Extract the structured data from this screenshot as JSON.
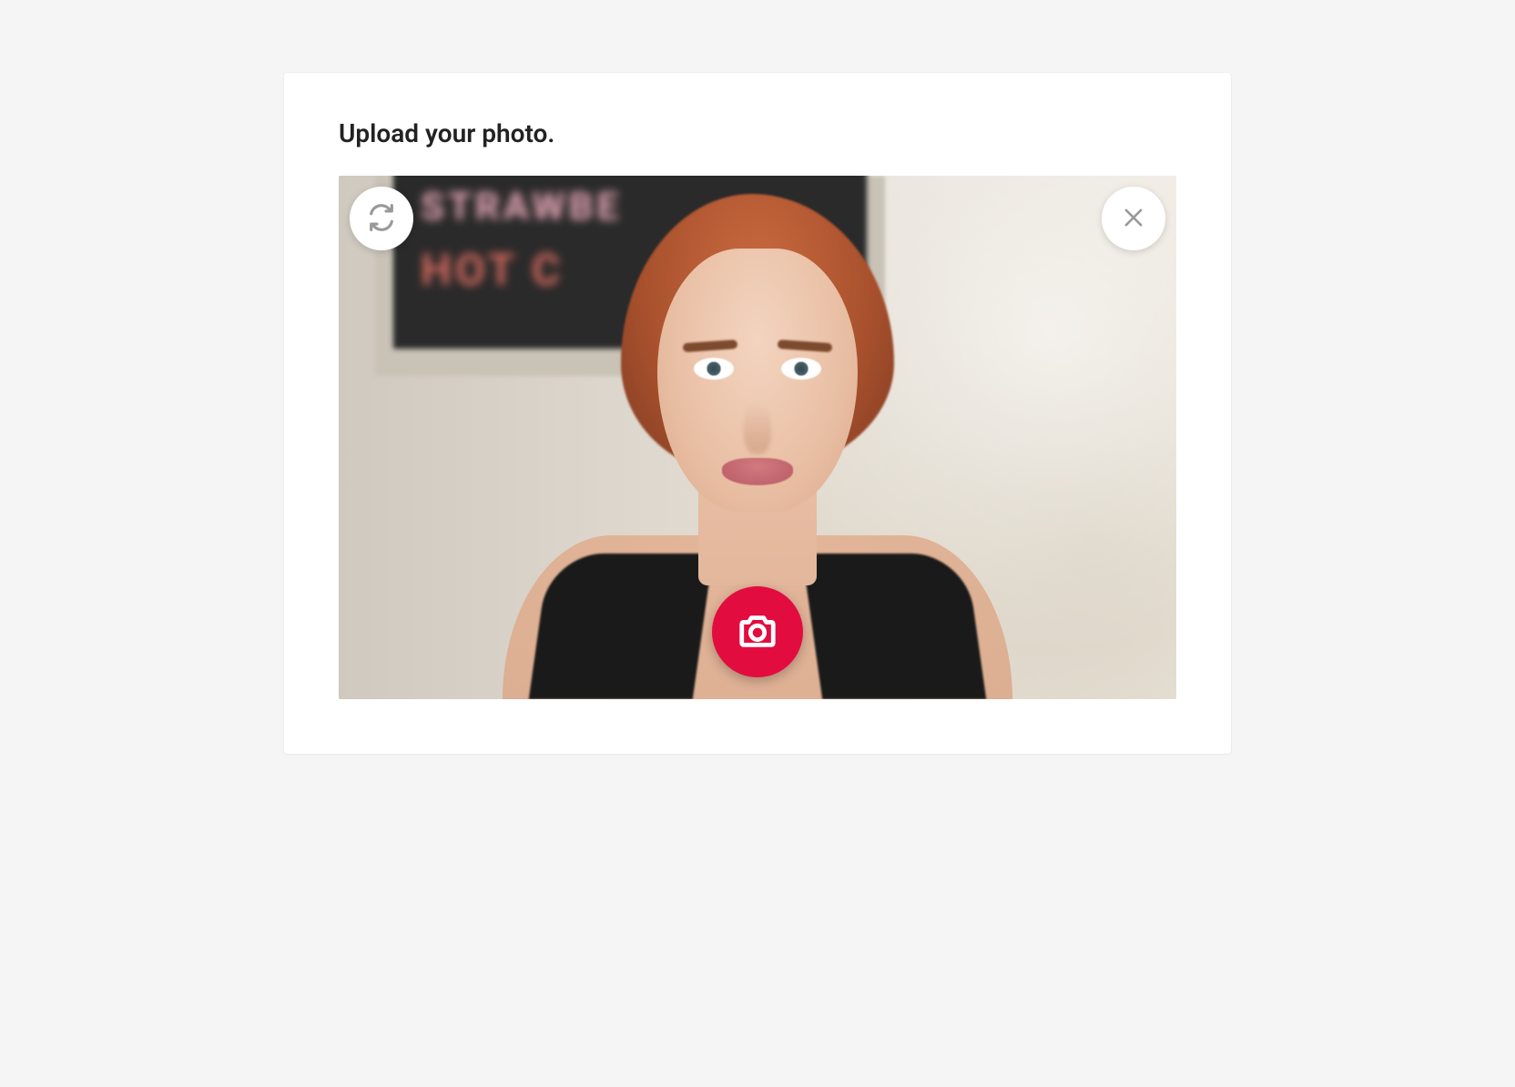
{
  "card": {
    "title": "Upload your photo."
  },
  "controls": {
    "switch_camera_icon": "switch-camera-icon",
    "close_icon": "close-icon",
    "capture_icon": "camera-icon"
  },
  "colors": {
    "accent": "#e30c3f",
    "icon_muted": "#999999",
    "card_bg": "#ffffff",
    "page_bg": "#f5f5f5"
  },
  "background_chalkboard": {
    "line1": "STRAWBE",
    "line2": "HOT C"
  }
}
